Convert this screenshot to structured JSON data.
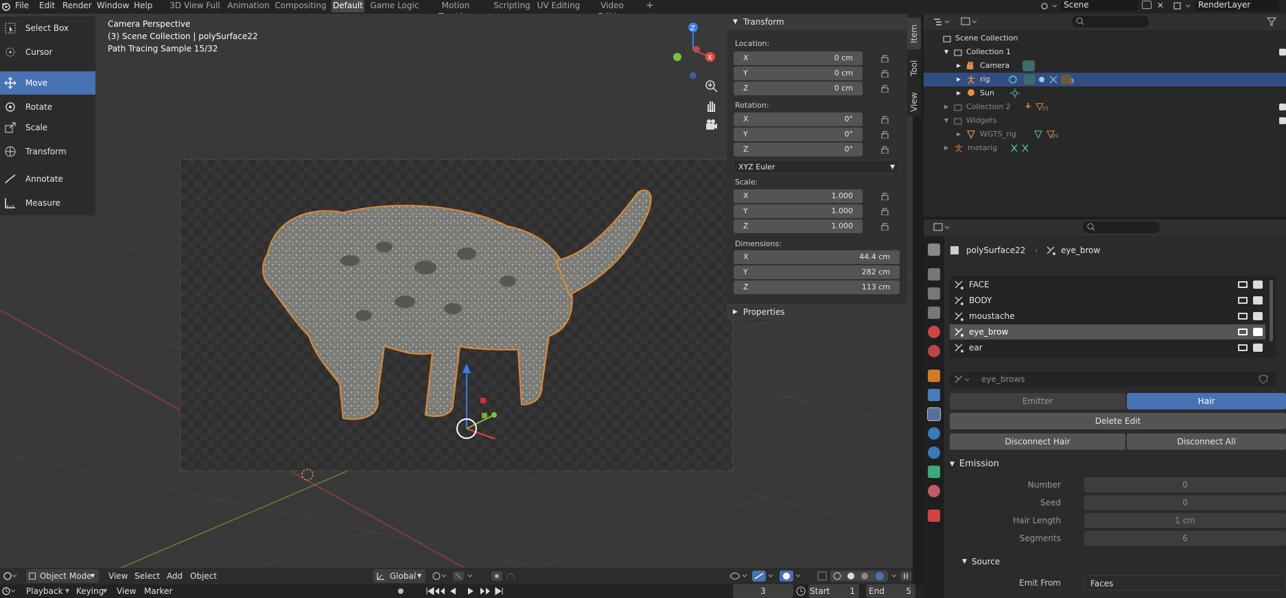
{
  "topbar": {
    "menus": [
      "File",
      "Edit",
      "Render",
      "Window",
      "Help"
    ],
    "workspaces": [
      "3D View Full",
      "Animation",
      "Compositing",
      "Default",
      "Game Logic",
      "Motion Tracking",
      "Scripting",
      "UV Editing",
      "Video Editing"
    ],
    "active_workspace": "Default",
    "add_tab": "+",
    "scene": "Scene",
    "render_layer": "RenderLayer"
  },
  "toolbar": [
    {
      "label": "Select Box",
      "icon": "select-box-icon"
    },
    {
      "label": "Cursor",
      "icon": "cursor-icon"
    },
    {
      "label": "Move",
      "icon": "move-icon",
      "active": true
    },
    {
      "label": "Rotate",
      "icon": "rotate-icon"
    },
    {
      "label": "Scale",
      "icon": "scale-icon"
    },
    {
      "label": "Transform",
      "icon": "transform-icon"
    },
    {
      "label": "Annotate",
      "icon": "annotate-icon"
    },
    {
      "label": "Measure",
      "icon": "measure-icon"
    }
  ],
  "viewport": {
    "overlay": [
      "Camera Perspective",
      "(3) Scene Collection | polySurface22",
      "Path Tracing Sample 15/32"
    ]
  },
  "transform_panel": {
    "title": "Transform",
    "location_label": "Location:",
    "location": [
      {
        "axis": "X",
        "value": "0 cm"
      },
      {
        "axis": "Y",
        "value": "0 cm"
      },
      {
        "axis": "Z",
        "value": "0 cm"
      }
    ],
    "rotation_label": "Rotation:",
    "rotation": [
      {
        "axis": "X",
        "value": "0°"
      },
      {
        "axis": "Y",
        "value": "0°"
      },
      {
        "axis": "Z",
        "value": "0°"
      }
    ],
    "rotation_mode": "XYZ Euler",
    "scale_label": "Scale:",
    "scale": [
      {
        "axis": "X",
        "value": "1.000"
      },
      {
        "axis": "Y",
        "value": "1.000"
      },
      {
        "axis": "Z",
        "value": "1.000"
      }
    ],
    "dimensions_label": "Dimensions:",
    "dimensions": [
      {
        "axis": "X",
        "value": "44.4 cm"
      },
      {
        "axis": "Y",
        "value": "282 cm"
      },
      {
        "axis": "Z",
        "value": "113 cm"
      }
    ],
    "properties_title": "Properties"
  },
  "side_tabs": [
    "Item",
    "Tool",
    "View"
  ],
  "outliner": {
    "rows": [
      {
        "label": "Scene Collection"
      },
      {
        "label": "Collection 1"
      },
      {
        "label": "Camera"
      },
      {
        "label": "rig",
        "selected": true,
        "badge": "3"
      },
      {
        "label": "Sun"
      },
      {
        "label": "Collection 2",
        "badge": "35"
      },
      {
        "label": "Widgets"
      },
      {
        "label": "WGTS_rig",
        "badge": "99"
      },
      {
        "label": "metarig"
      }
    ]
  },
  "properties": {
    "object": "polySurface22",
    "system": "eye_brow",
    "particle_systems": [
      "FACE",
      "BODY",
      "moustache",
      "eye_brow",
      "ear"
    ],
    "selected_system": "eye_brow",
    "settings_name": "eye_brows",
    "type_emitter": "Emitter",
    "type_hair": "Hair",
    "delete_edit": "Delete Edit",
    "disconnect_hair": "Disconnect Hair",
    "disconnect_all": "Disconnect All",
    "emission_title": "Emission",
    "fields": [
      {
        "label": "Number",
        "value": "0"
      },
      {
        "label": "Seed",
        "value": "0"
      },
      {
        "label": "Hair Length",
        "value": "1 cm"
      },
      {
        "label": "Segments",
        "value": "6"
      }
    ],
    "source_title": "Source",
    "emit_from_label": "Emit From",
    "emit_from_value": "Faces"
  },
  "viewport_header": {
    "mode": "Object Mode",
    "menus": [
      "View",
      "Select",
      "Add",
      "Object"
    ],
    "orientation": "Global"
  },
  "timeline": {
    "menus": [
      "Playback",
      "Keying",
      "View",
      "Marker"
    ],
    "current_frame": "3",
    "start_label": "Start",
    "start": "1",
    "end_label": "End",
    "end": "5"
  }
}
